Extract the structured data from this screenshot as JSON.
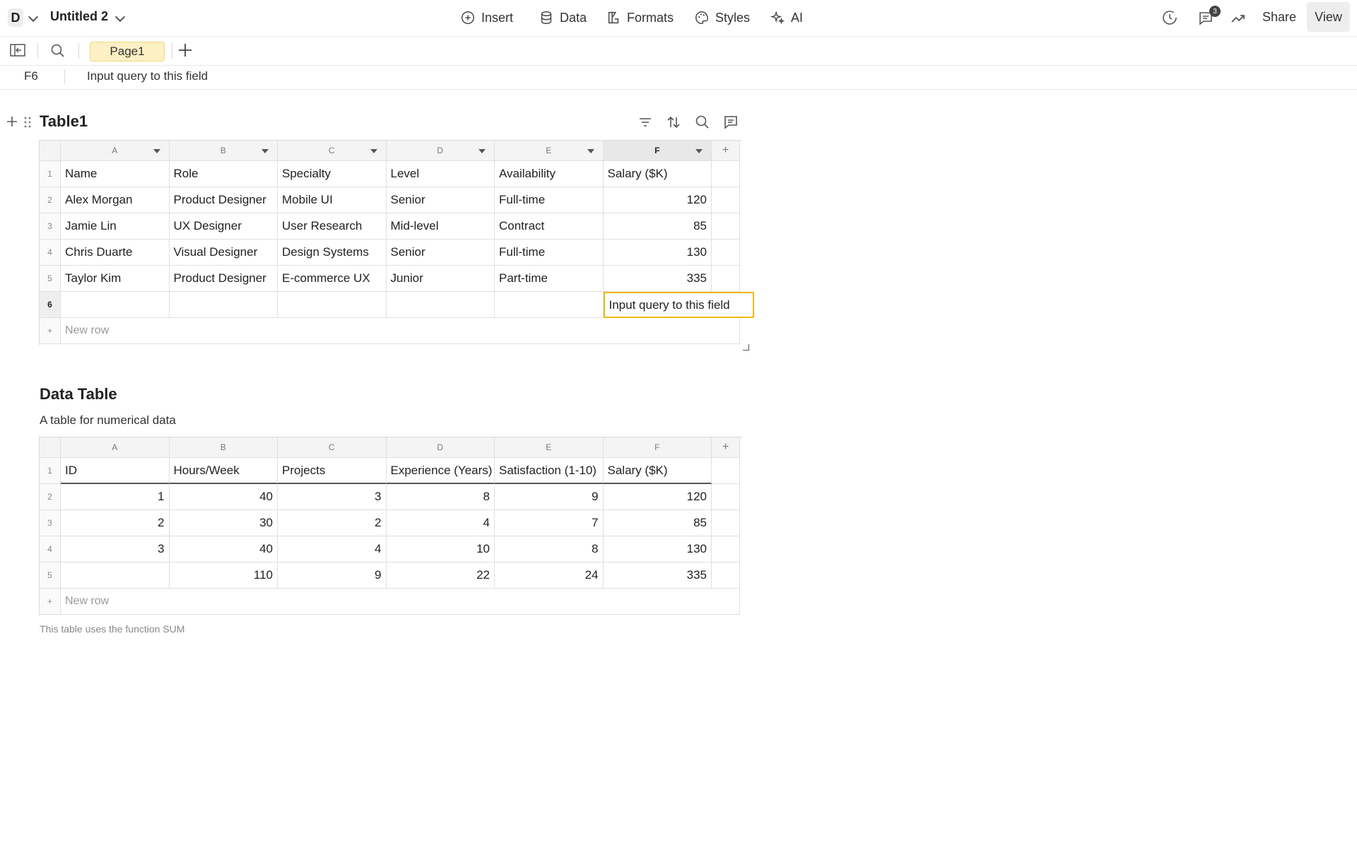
{
  "topbar": {
    "doc_initial": "D",
    "doc_title": "Untitled 2",
    "menu": [
      {
        "label": "Insert",
        "icon": "plus-circle-icon"
      },
      {
        "label": "Data",
        "icon": "database-icon"
      },
      {
        "label": "Formats",
        "icon": "formats-icon"
      },
      {
        "label": "Styles",
        "icon": "palette-icon"
      },
      {
        "label": "AI",
        "icon": "sparkle-icon"
      }
    ],
    "comment_count": "3",
    "share_label": "Share",
    "view_label": "View"
  },
  "subbar": {
    "page_tab": "Page1"
  },
  "formula": {
    "cell_ref": "F6",
    "value": "Input query to this field"
  },
  "table1": {
    "title": "Table1",
    "columns": [
      "A",
      "B",
      "C",
      "D",
      "E",
      "F"
    ],
    "rows": [
      {
        "n": "1",
        "cells": [
          "Name",
          "Role",
          "Specialty",
          "Level",
          "Availability",
          "Salary ($K)"
        ]
      },
      {
        "n": "2",
        "cells": [
          "Alex Morgan",
          "Product Designer",
          "Mobile UI",
          "Senior",
          "Full-time",
          "120"
        ]
      },
      {
        "n": "3",
        "cells": [
          "Jamie Lin",
          "UX Designer",
          "User Research",
          "Mid-level",
          "Contract",
          "85"
        ]
      },
      {
        "n": "4",
        "cells": [
          "Chris Duarte",
          "Visual Designer",
          "Design Systems",
          "Senior",
          "Full-time",
          "130"
        ]
      },
      {
        "n": "5",
        "cells": [
          "Taylor Kim",
          "Product Designer",
          "E-commerce UX",
          "Junior",
          "Part-time",
          "335"
        ]
      },
      {
        "n": "6",
        "cells": [
          "",
          "",
          "",
          "",
          "",
          "Input query to this field"
        ]
      }
    ],
    "new_row": "New row",
    "add_col": "+"
  },
  "table2": {
    "title": "Data Table",
    "description": "A table for numerical data",
    "columns": [
      "A",
      "B",
      "C",
      "D",
      "E",
      "F"
    ],
    "rows": [
      {
        "n": "1",
        "cells": [
          "ID",
          "Hours/Week",
          "Projects",
          "Experience (Years)",
          "Satisfaction (1-10)",
          "Salary ($K)"
        ]
      },
      {
        "n": "2",
        "cells": [
          "1",
          "40",
          "3",
          "8",
          "9",
          "120"
        ]
      },
      {
        "n": "3",
        "cells": [
          "2",
          "30",
          "2",
          "4",
          "7",
          "85"
        ]
      },
      {
        "n": "4",
        "cells": [
          "3",
          "40",
          "4",
          "10",
          "8",
          "130"
        ]
      },
      {
        "n": "5",
        "cells": [
          "",
          "110",
          "9",
          "22",
          "24",
          "335"
        ]
      }
    ],
    "new_row": "New row",
    "add_col": "+",
    "footnote": "This table uses the function SUM"
  }
}
